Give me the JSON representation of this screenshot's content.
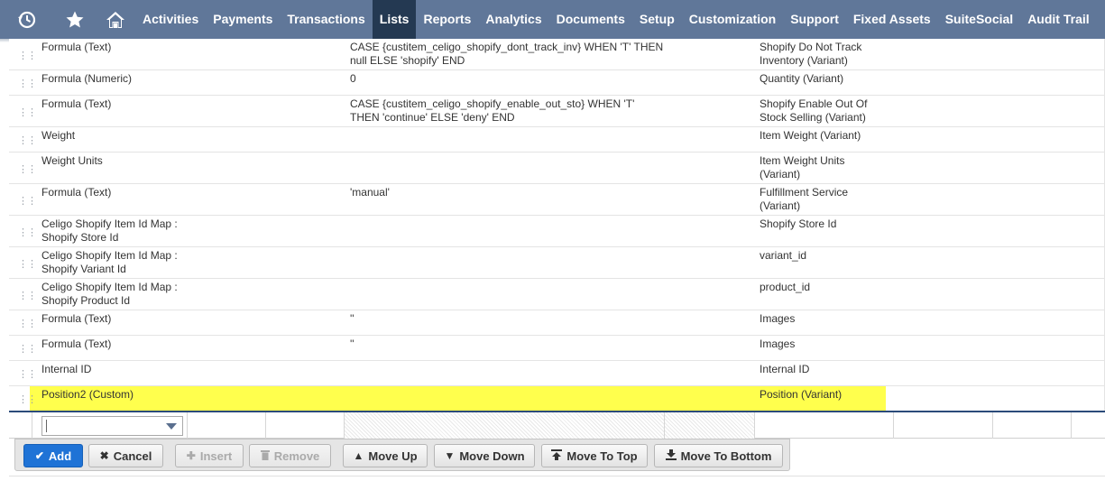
{
  "nav": {
    "icons": [
      "recent-icon",
      "star-icon",
      "home-icon"
    ],
    "items": [
      {
        "label": "Activities"
      },
      {
        "label": "Payments"
      },
      {
        "label": "Transactions"
      },
      {
        "label": "Lists",
        "active": true
      },
      {
        "label": "Reports"
      },
      {
        "label": "Analytics"
      },
      {
        "label": "Documents"
      },
      {
        "label": "Setup"
      },
      {
        "label": "Customization"
      },
      {
        "label": "Support"
      },
      {
        "label": "Fixed Assets"
      },
      {
        "label": "SuiteSocial"
      },
      {
        "label": "Audit Trail"
      }
    ],
    "active_color": "#243952",
    "bar_color": "#607799"
  },
  "rows": [
    {
      "field": "Formula (Text)",
      "formula": "CASE {custitem_celigo_shopify_dont_track_inv} WHEN 'T' THEN null ELSE 'shopify' END",
      "label": "Shopify Do Not Track Inventory (Variant)"
    },
    {
      "field": "Formula (Numeric)",
      "formula": "0",
      "label": "Quantity (Variant)"
    },
    {
      "field": "Formula (Text)",
      "formula": "CASE {custitem_celigo_shopify_enable_out_sto} WHEN 'T' THEN 'continue' ELSE 'deny' END",
      "label": "Shopify Enable Out Of Stock Selling (Variant)"
    },
    {
      "field": "Weight",
      "formula": "",
      "label": "Item Weight (Variant)"
    },
    {
      "field": "Weight Units",
      "formula": "",
      "label": "Item Weight Units (Variant)"
    },
    {
      "field": "Formula (Text)",
      "formula": "'manual'",
      "label": "Fulfillment Service (Variant)"
    },
    {
      "field": "Celigo Shopify Item Id Map : Shopify Store Id",
      "formula": "",
      "label": "Shopify Store Id"
    },
    {
      "field": "Celigo Shopify Item Id Map : Shopify Variant Id",
      "formula": "",
      "label": "variant_id"
    },
    {
      "field": "Celigo Shopify Item Id Map : Shopify Product Id",
      "formula": "",
      "label": "product_id"
    },
    {
      "field": "Formula (Text)",
      "formula": "''",
      "label": "Images"
    },
    {
      "field": "Formula (Text)",
      "formula": "''",
      "label": "Images"
    },
    {
      "field": "Internal ID",
      "formula": "",
      "label": "Internal ID"
    },
    {
      "field": "Position2 (Custom)",
      "formula": "",
      "label": "Position (Variant)",
      "highlighted": true
    }
  ],
  "highlight_color": "#ffff4d",
  "edit_row": {
    "select_value": ""
  },
  "buttons": {
    "add": "Add",
    "cancel": "Cancel",
    "insert": "Insert",
    "remove": "Remove",
    "move_up": "Move Up",
    "move_down": "Move Down",
    "move_to_top": "Move To Top",
    "move_to_bottom": "Move To Bottom"
  }
}
